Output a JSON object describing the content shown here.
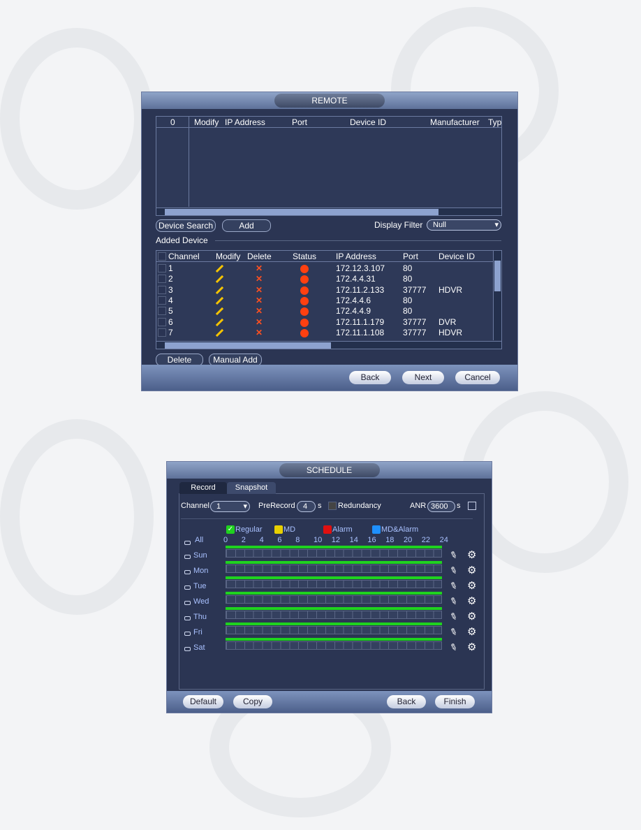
{
  "remote": {
    "title": "REMOTE",
    "search_table": {
      "headers": [
        "0",
        "Modify",
        "IP Address",
        "Port",
        "Device ID",
        "Manufacturer",
        "Typ"
      ]
    },
    "device_search_label": "Device Search",
    "add_label": "Add",
    "display_filter_label": "Display Filter",
    "display_filter_value": "Null",
    "added_device_label": "Added Device",
    "added_table": {
      "headers": [
        "Channel",
        "Modify",
        "Delete",
        "Status",
        "IP Address",
        "Port",
        "Device ID"
      ],
      "rows": [
        {
          "channel": "1",
          "ip": "172.12.3.107",
          "port": "80",
          "device_id": ""
        },
        {
          "channel": "2",
          "ip": "172.4.4.31",
          "port": "80",
          "device_id": ""
        },
        {
          "channel": "3",
          "ip": "172.11.2.133",
          "port": "37777",
          "device_id": "HDVR"
        },
        {
          "channel": "4",
          "ip": "172.4.4.6",
          "port": "80",
          "device_id": ""
        },
        {
          "channel": "5",
          "ip": "172.4.4.9",
          "port": "80",
          "device_id": ""
        },
        {
          "channel": "6",
          "ip": "172.11.1.179",
          "port": "37777",
          "device_id": "DVR"
        },
        {
          "channel": "7",
          "ip": "172.11.1.108",
          "port": "37777",
          "device_id": "HDVR"
        }
      ]
    },
    "status_color": "#ff4010",
    "delete_label": "Delete",
    "manual_add_label": "Manual Add",
    "back_label": "Back",
    "next_label": "Next",
    "cancel_label": "Cancel"
  },
  "schedule": {
    "title": "SCHEDULE",
    "tabs": [
      {
        "label": "Record",
        "active": true
      },
      {
        "label": "Snapshot",
        "active": false
      }
    ],
    "channel_label": "Channel",
    "channel_value": "1",
    "prerecord_label": "PreRecord",
    "prerecord_value": "4",
    "prerecord_unit": "s",
    "redundancy_label": "Redundancy",
    "anr_label": "ANR",
    "anr_value": "3600",
    "anr_unit": "s",
    "legend": [
      {
        "label": "Regular",
        "color": "#1fd21f",
        "checked": true
      },
      {
        "label": "MD",
        "color": "#e8d000"
      },
      {
        "label": "Alarm",
        "color": "#e01010"
      },
      {
        "label": "MD&Alarm",
        "color": "#1e90ff"
      }
    ],
    "all_label": "All",
    "hours": [
      "0",
      "2",
      "4",
      "6",
      "8",
      "10",
      "12",
      "14",
      "16",
      "18",
      "20",
      "22",
      "24"
    ],
    "days": [
      {
        "label": "Sun",
        "regular": [
          0,
          24
        ]
      },
      {
        "label": "Mon",
        "regular": [
          0,
          24
        ]
      },
      {
        "label": "Tue",
        "regular": [
          0,
          24
        ]
      },
      {
        "label": "Wed",
        "regular": [
          0,
          24
        ]
      },
      {
        "label": "Thu",
        "regular": [
          0,
          24
        ]
      },
      {
        "label": "Fri",
        "regular": [
          0,
          24
        ]
      },
      {
        "label": "Sat",
        "regular": [
          0,
          24
        ]
      }
    ],
    "default_label": "Default",
    "copy_label": "Copy",
    "back_label": "Back",
    "finish_label": "Finish"
  }
}
